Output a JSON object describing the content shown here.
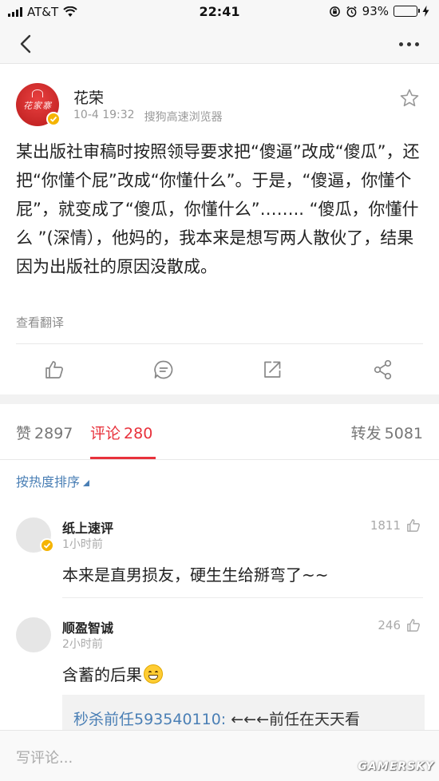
{
  "status_bar": {
    "carrier": "AT&T",
    "time": "22:41",
    "battery_percent": "93%",
    "battery_level": 0.93,
    "battery_color": "#4cd964"
  },
  "nav": {
    "back_icon": "chevron-left-icon",
    "more_icon": "more-horizontal-icon"
  },
  "post": {
    "author": "花荣",
    "avatar_text": "花家寨",
    "date": "10-4 19:32",
    "source": "搜狗高速浏览器",
    "text": "某出版社审稿时按照领导要求把“傻逼”改成“傻瓜”，还把“你懂个屁”改成“你懂什么”。于是，“傻逼，你懂个屁”，就变成了“傻瓜，你懂什么”…….. “傻瓜，你懂什么 ”(深情），他妈的，我本来是想写两人散伙了，结果因为出版社的原因没散成。",
    "translate_label": "查看翻译",
    "actions": [
      "thumbs-up-icon",
      "comment-icon",
      "repost-icon",
      "share-icon"
    ]
  },
  "tabs": {
    "like_label": "赞",
    "like_count": "2897",
    "comment_label": "评论",
    "comment_count": "280",
    "repost_label": "转发",
    "repost_count": "5081",
    "accent_color": "#e8323c"
  },
  "sort": {
    "label": "按热度排序"
  },
  "comments": [
    {
      "name": "纸上速评",
      "time": "1小时前",
      "likes": "1811",
      "text": "本来是直男损友，硬生生给掰弯了~~",
      "verified": true
    },
    {
      "name": "顺盈智诚",
      "time": "2小时前",
      "likes": "246",
      "text": "含蓄的后果",
      "emoji": "grinning-face-icon",
      "verified": false,
      "reply": {
        "author": "秒杀前任593540110:",
        "text": " ←←←前任在天天看"
      }
    }
  ],
  "input": {
    "placeholder": "写评论..."
  },
  "watermark": "GAMERSKY"
}
